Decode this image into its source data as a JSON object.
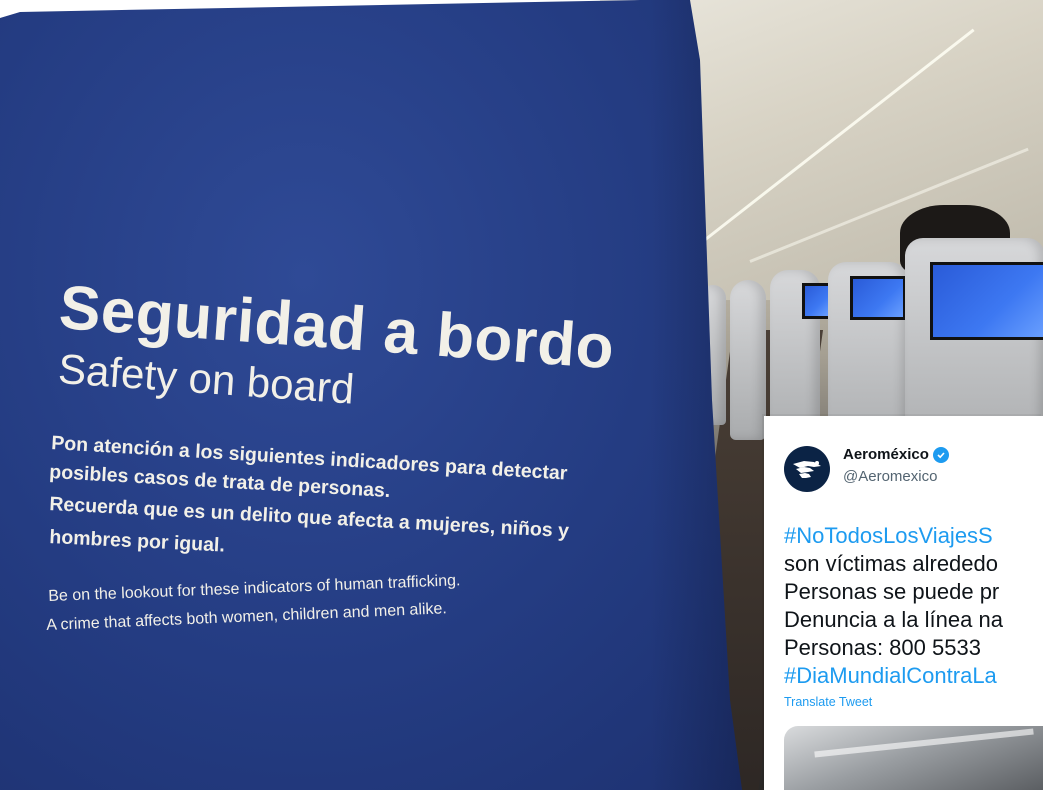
{
  "card": {
    "title_es": "Seguridad a bordo",
    "title_en": "Safety on board",
    "body_es": [
      "Pon atención a los siguientes indicadores para detectar",
      "posibles casos de trata de personas.",
      "Recuerda que es un delito que afecta a mujeres, niños y",
      "hombres por igual."
    ],
    "body_en": [
      "Be on the lookout for these indicators of human trafficking.",
      "A crime that affects both women, children and men alike."
    ],
    "color": "#243c82"
  },
  "tweet": {
    "name": "Aeroméxico",
    "handle": "@Aeromexico",
    "lines": [
      "#NoTodosLosViajesS",
      "son víctimas alrededo",
      "Personas se puede pr",
      "Denuncia a la línea na",
      "Personas: 800 5533",
      "#DiaMundialContraLa"
    ],
    "translate_label": "Translate Tweet",
    "link_color": "#1d9bf0",
    "avatar_icon": "aeromexico-logo-icon",
    "verified_icon": "verified-badge-icon"
  }
}
